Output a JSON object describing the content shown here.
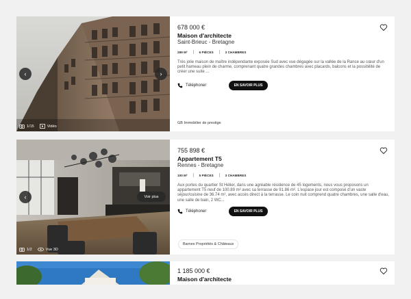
{
  "listings": [
    {
      "price": "678 000 €",
      "title": "Maison d'architecte",
      "location": "Saint-Brieuc - Bretagne",
      "specs": [
        "289 M²",
        "6 PIÈCES",
        "3 CHAMBRES"
      ],
      "description": "Très jolie maison de maître indépendante exposée Sud avec vue dégagée sur la vallée de la Rance au cœur d'un petit hameau plein de charme, comprenant quatre grandes chambres avec placards, balcons et la possibilité de créer une suite ...",
      "phone_label": "Téléphoner",
      "more_label": "EN SAVOIR PLUS",
      "agency": "GB Immobilier de prestige",
      "photo_count": "1/15",
      "media_label": "Vidéo",
      "prev_icon": "‹",
      "next_icon": "›"
    },
    {
      "price": "755 898 €",
      "title": "Appartement T5",
      "location": "Rennes - Bretagne",
      "specs": [
        "100 M²",
        "5 PIÈCES",
        "3 CHAMBRES"
      ],
      "description": "Aux portes du quartier St Hélier, dans une agréable résidence de 45 logements, nous vous proposons un appartement T5 neuf de 100.89 m² avec sa terrasse de 91.86 m². L'espace jour est composé d'un vaste séjour/cuisine de 36.74 m², avec accès direct à la terrasse. Le coin nuit comprend quatre chambres, une salle d'eau, une salle de bain, 2 WC...",
      "phone_label": "Téléphoner",
      "more_label": "EN SAVOIR PLUS",
      "agency": "Barnes Propriétés & Châteaux",
      "photo_count": "1/2",
      "media_label": "Vue 3D",
      "voir_plus": "Voir plus",
      "prev_icon": "‹",
      "next_icon": "›"
    },
    {
      "price": "1 185 000 €",
      "title": "Maison d'architecte"
    }
  ],
  "colors": {
    "page_bg": "#f1f1f1",
    "card_bg": "#ffffff",
    "button_bg": "#111111",
    "overlay": "#282828"
  }
}
